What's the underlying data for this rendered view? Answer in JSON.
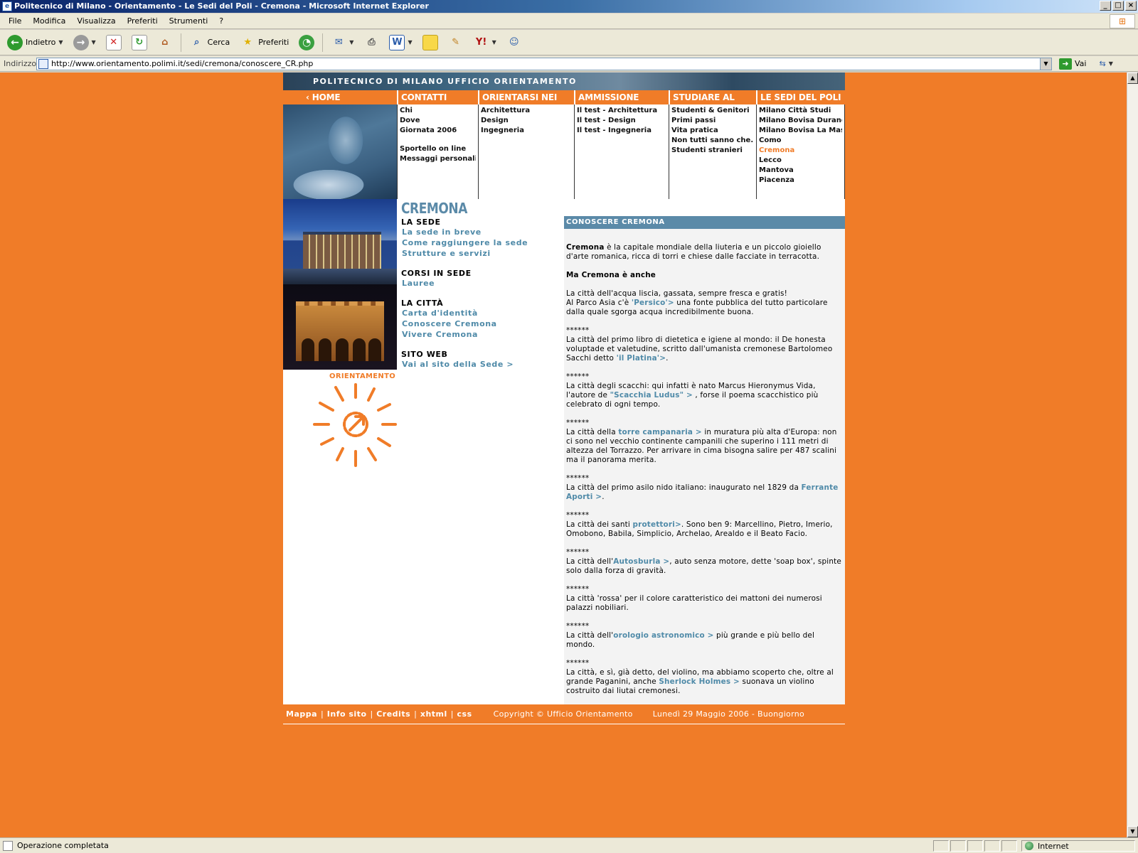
{
  "window": {
    "title": "Politecnico di Milano - Orientamento - Le Sedi del Poli - Cremona - Microsoft Internet Explorer",
    "buttons": [
      "_",
      "□",
      "×"
    ]
  },
  "menubar": [
    "File",
    "Modifica",
    "Visualizza",
    "Preferiti",
    "Strumenti",
    "?"
  ],
  "toolbar": {
    "back": "Indietro",
    "search": "Cerca",
    "favorites": "Preferiti"
  },
  "address": {
    "label": "Indirizzo",
    "url": "http://www.orientamento.polimi.it/sedi/cremona/conoscere_CR.php",
    "go": "Vai"
  },
  "status": {
    "text": "Operazione completata",
    "zone": "Internet"
  },
  "site": {
    "banner": "POLITECNICO DI MILANO UFFICIO ORIENTAMENTO",
    "nav": {
      "home": "HOME",
      "tabs": [
        "CONTATTI",
        "ORIENTARSI NEI CORSI",
        "AMMISSIONE",
        "STUDIARE AL POLI",
        "LE SEDI DEL POLI"
      ],
      "contatti": [
        "Chi",
        "Dove",
        "Giornata 2006",
        "Sportello on line",
        "Messaggi personali"
      ],
      "orientarsi": [
        "Architettura",
        "Design",
        "Ingegneria"
      ],
      "ammissione": [
        "Il test - Architettura",
        "Il test - Design",
        "Il test - Ingegneria"
      ],
      "studiare": [
        "Studenti & Genitori",
        "Primi passi",
        "Vita pratica",
        "Non tutti sanno che...",
        "Studenti stranieri"
      ],
      "sedi": [
        "Milano Città Studi",
        "Milano Bovisa Durando",
        "Milano Bovisa La Masa",
        "Como",
        "Cremona",
        "Lecco",
        "Mantova",
        "Piacenza"
      ]
    },
    "city": "CREMONA",
    "sections": {
      "sede_head": "LA SEDE",
      "sede_links": [
        "La sede in breve",
        "Come raggiungere la sede",
        "Strutture e servizi"
      ],
      "corsi_head": "CORSI IN SEDE",
      "corsi_links": [
        "Lauree"
      ],
      "citta_head": "LA CITTÀ",
      "citta_links": [
        "Carta d'identità",
        "Conoscere Cremona",
        "Vivere Cremona"
      ],
      "web_head": "SITO WEB",
      "web_links": [
        "Vai al sito della Sede >"
      ]
    },
    "orient_label": "ORIENTAMENTO",
    "article": {
      "heading": "CONOSCERE CREMONA",
      "p1_bold": "Cremona",
      "p1_rest": " è la capitale mondiale della liuteria e un piccolo gioiello d'arte romanica, ricca di torri e chiese dalle facciate in terracotta.",
      "p2": "Ma Cremona è anche",
      "p3a": "La città dell'acqua liscia, gassata, sempre fresca e gratis!",
      "p3b": "Al Parco Asia c'è ",
      "p3_link": "'Persico'>",
      "p3c": " una fonte pubblica del tutto particolare dalla quale sgorga acqua incredibilmente buona.",
      "stars": "******",
      "p4a": "La città del primo libro di dietetica e igiene al mondo: il De honesta voluptade et valetudine, scritto dall'umanista cremonese Bartolomeo Sacchi detto ",
      "p4_link": "'il Platina'>",
      "p4b": ".",
      "p5a": "La città degli scacchi: qui infatti è nato Marcus Hieronymus Vida, l'autore de ",
      "p5_link": "\"Scacchia Ludus\" >",
      "p5b": " , forse il poema scacchistico più celebrato di ogni tempo.",
      "p6a": "La città della ",
      "p6_link": "torre campanaria >",
      "p6b": " in muratura più alta d'Europa: non ci sono nel vecchio continente campanili che superino i 111 metri di altezza del Torrazzo. Per arrivare in cima bisogna salire per 487 scalini ma il panorama merita.",
      "p7a": "La città del primo asilo nido italiano: inaugurato nel 1829 da ",
      "p7_link": "Ferrante Aporti >",
      "p7b": ".",
      "p8a": "La città dei santi ",
      "p8_link": "protettori>",
      "p8b": ". Sono ben 9: Marcellino, Pietro, Imerio, Omobono, Babila, Simplicio, Archelao, Arealdo e il Beato Facio.",
      "p9a": "La città dell'",
      "p9_link": "Autosburla >",
      "p9b": ", auto senza motore, dette 'soap box', spinte solo dalla forza di gravità.",
      "p10": "La città 'rossa' per il colore caratteristico dei mattoni dei numerosi palazzi nobiliari.",
      "p11a": "La città dell'",
      "p11_link": "orologio astronomico >",
      "p11b": " più grande e più bello del mondo.",
      "p12a": "La città, e sì, già detto, del violino, ma abbiamo scoperto che, oltre al grande Paganini, anche ",
      "p12_link": "Sherlock Holmes >",
      "p12b": " suonava un violino costruito dai liutai cremonesi."
    },
    "footer": {
      "links": [
        "Mappa",
        "Info sito",
        "Credits",
        "xhtml",
        "css"
      ],
      "sep": "|",
      "copyright": "Copyright © Ufficio Orientamento",
      "date": "Lunedì 29 Maggio 2006 - Buongiorno"
    }
  },
  "colors": {
    "page_bg": "#f07c28",
    "accent_blue": "#5b8aa8",
    "link_blue": "#4f8aa8"
  }
}
